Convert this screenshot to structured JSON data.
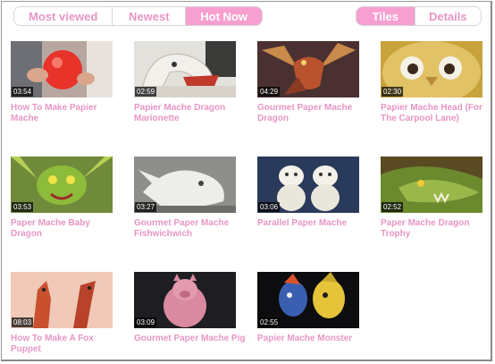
{
  "sort_tabs": [
    {
      "label": "Most viewed",
      "active": false
    },
    {
      "label": "Newest",
      "active": false
    },
    {
      "label": "Hot Now",
      "active": true
    }
  ],
  "view_tabs": [
    {
      "label": "Tiles",
      "active": true
    },
    {
      "label": "Details",
      "active": false
    }
  ],
  "videos": [
    {
      "title": "How To Make Papier Mache",
      "duration": "03:54"
    },
    {
      "title": "Papier Mache Dragon Marionette",
      "duration": "02:59"
    },
    {
      "title": "Gourmet Paper Mache Dragon",
      "duration": "04:29"
    },
    {
      "title": "Papier Mache Head (For The Carpool Lane)",
      "duration": "02:30"
    },
    {
      "title": "Paper Mache Baby Dragon",
      "duration": "03:53"
    },
    {
      "title": "Gourmet Paper Mache Fishwichwich",
      "duration": "03:27"
    },
    {
      "title": "Parallel Paper Mache",
      "duration": "03:06"
    },
    {
      "title": "Paper Mache Dragon Trophy",
      "duration": "02:52"
    },
    {
      "title": "How To Make A Fox Puppet",
      "duration": "08:03"
    },
    {
      "title": "Gourmet Paper Mache Pig",
      "duration": "03:09"
    },
    {
      "title": "Papier Mache Monster",
      "duration": "02:55"
    }
  ]
}
